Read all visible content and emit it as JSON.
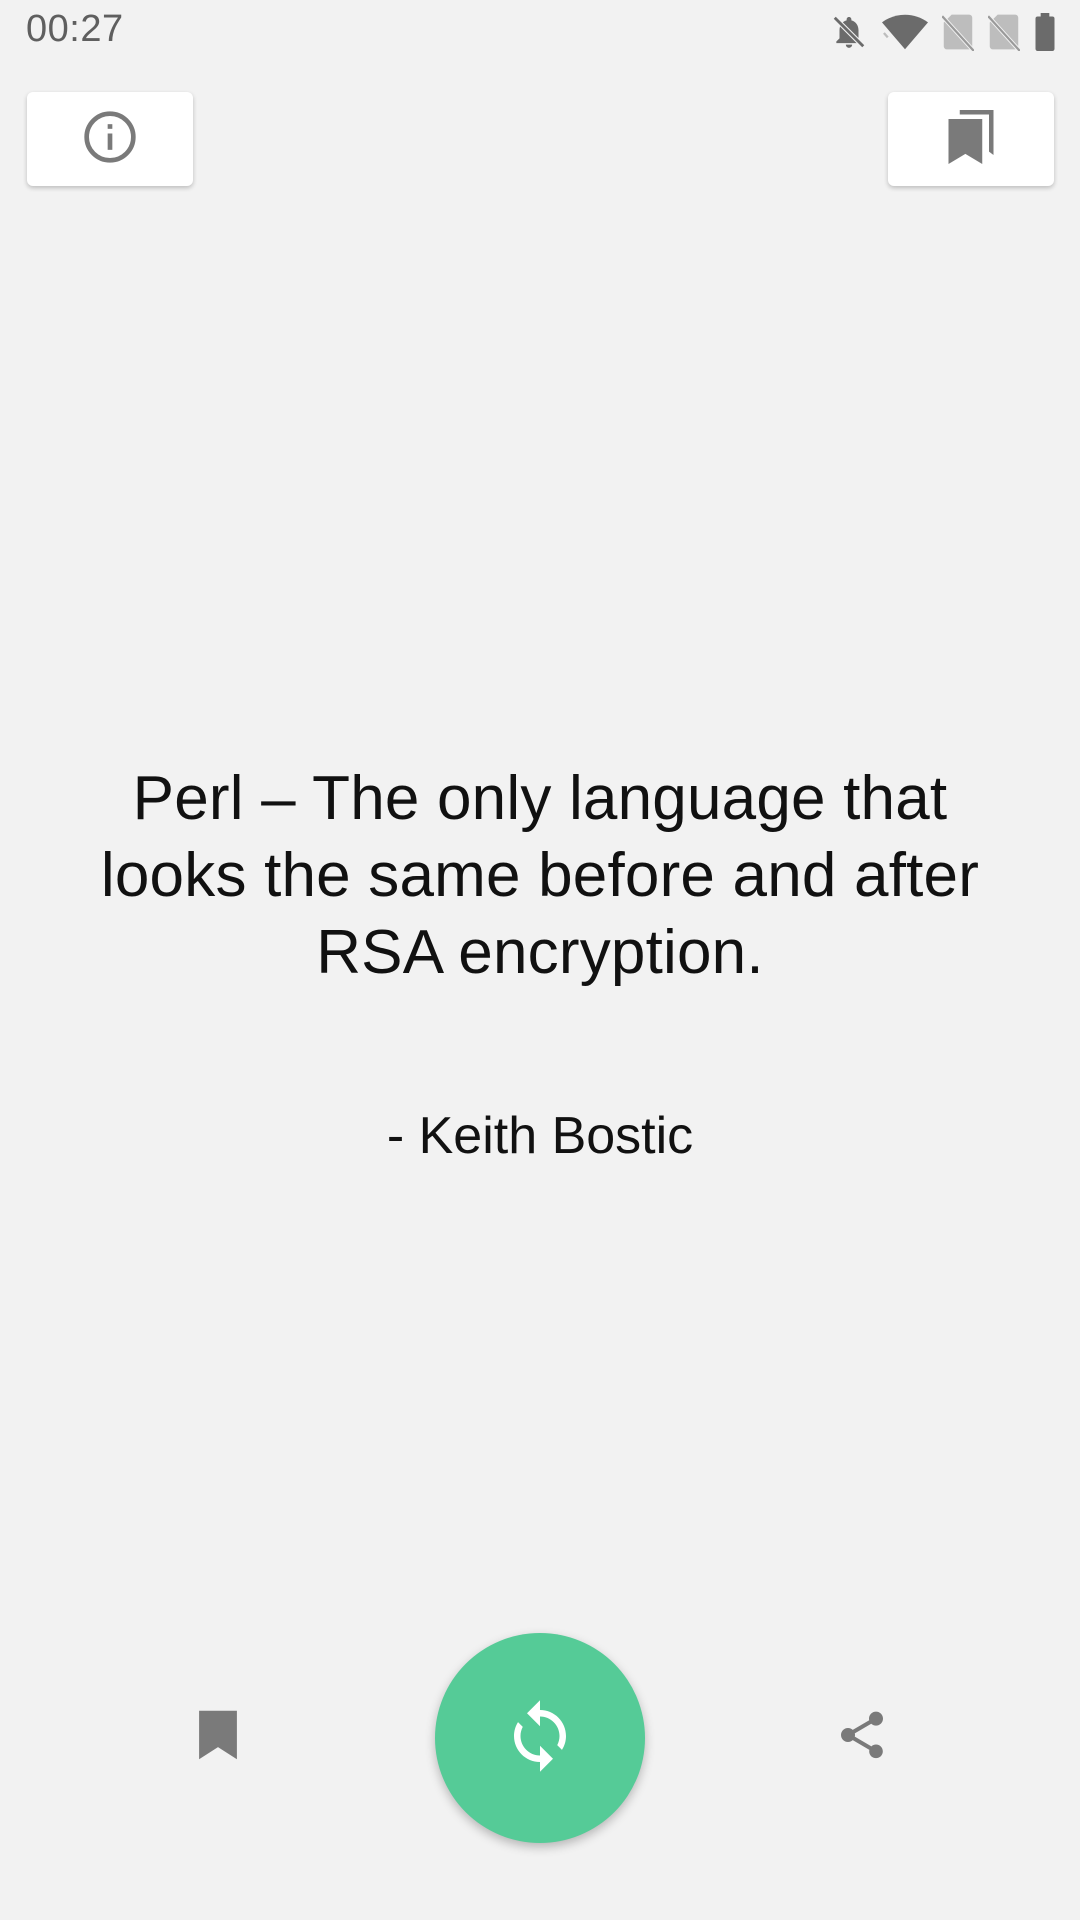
{
  "status_bar": {
    "time": "00:27",
    "icons": [
      "notifications-off-icon",
      "wifi-icon",
      "no-sim-icon",
      "no-sim-icon",
      "battery-icon"
    ]
  },
  "top_bar": {
    "info_icon": "info-icon",
    "bookmarks_icon": "bookmarks-icon"
  },
  "quote": {
    "text": "Perl – The only language that looks the same before and after RSA encryption.",
    "author": "- Keith Bostic"
  },
  "actions": {
    "bookmark_icon": "bookmark-icon",
    "refresh_icon": "refresh-icon",
    "share_icon": "share-icon"
  },
  "colors": {
    "background": "#f2f2f2",
    "accent": "#55cb97",
    "icon": "#7a7a7a",
    "text": "#111111"
  }
}
